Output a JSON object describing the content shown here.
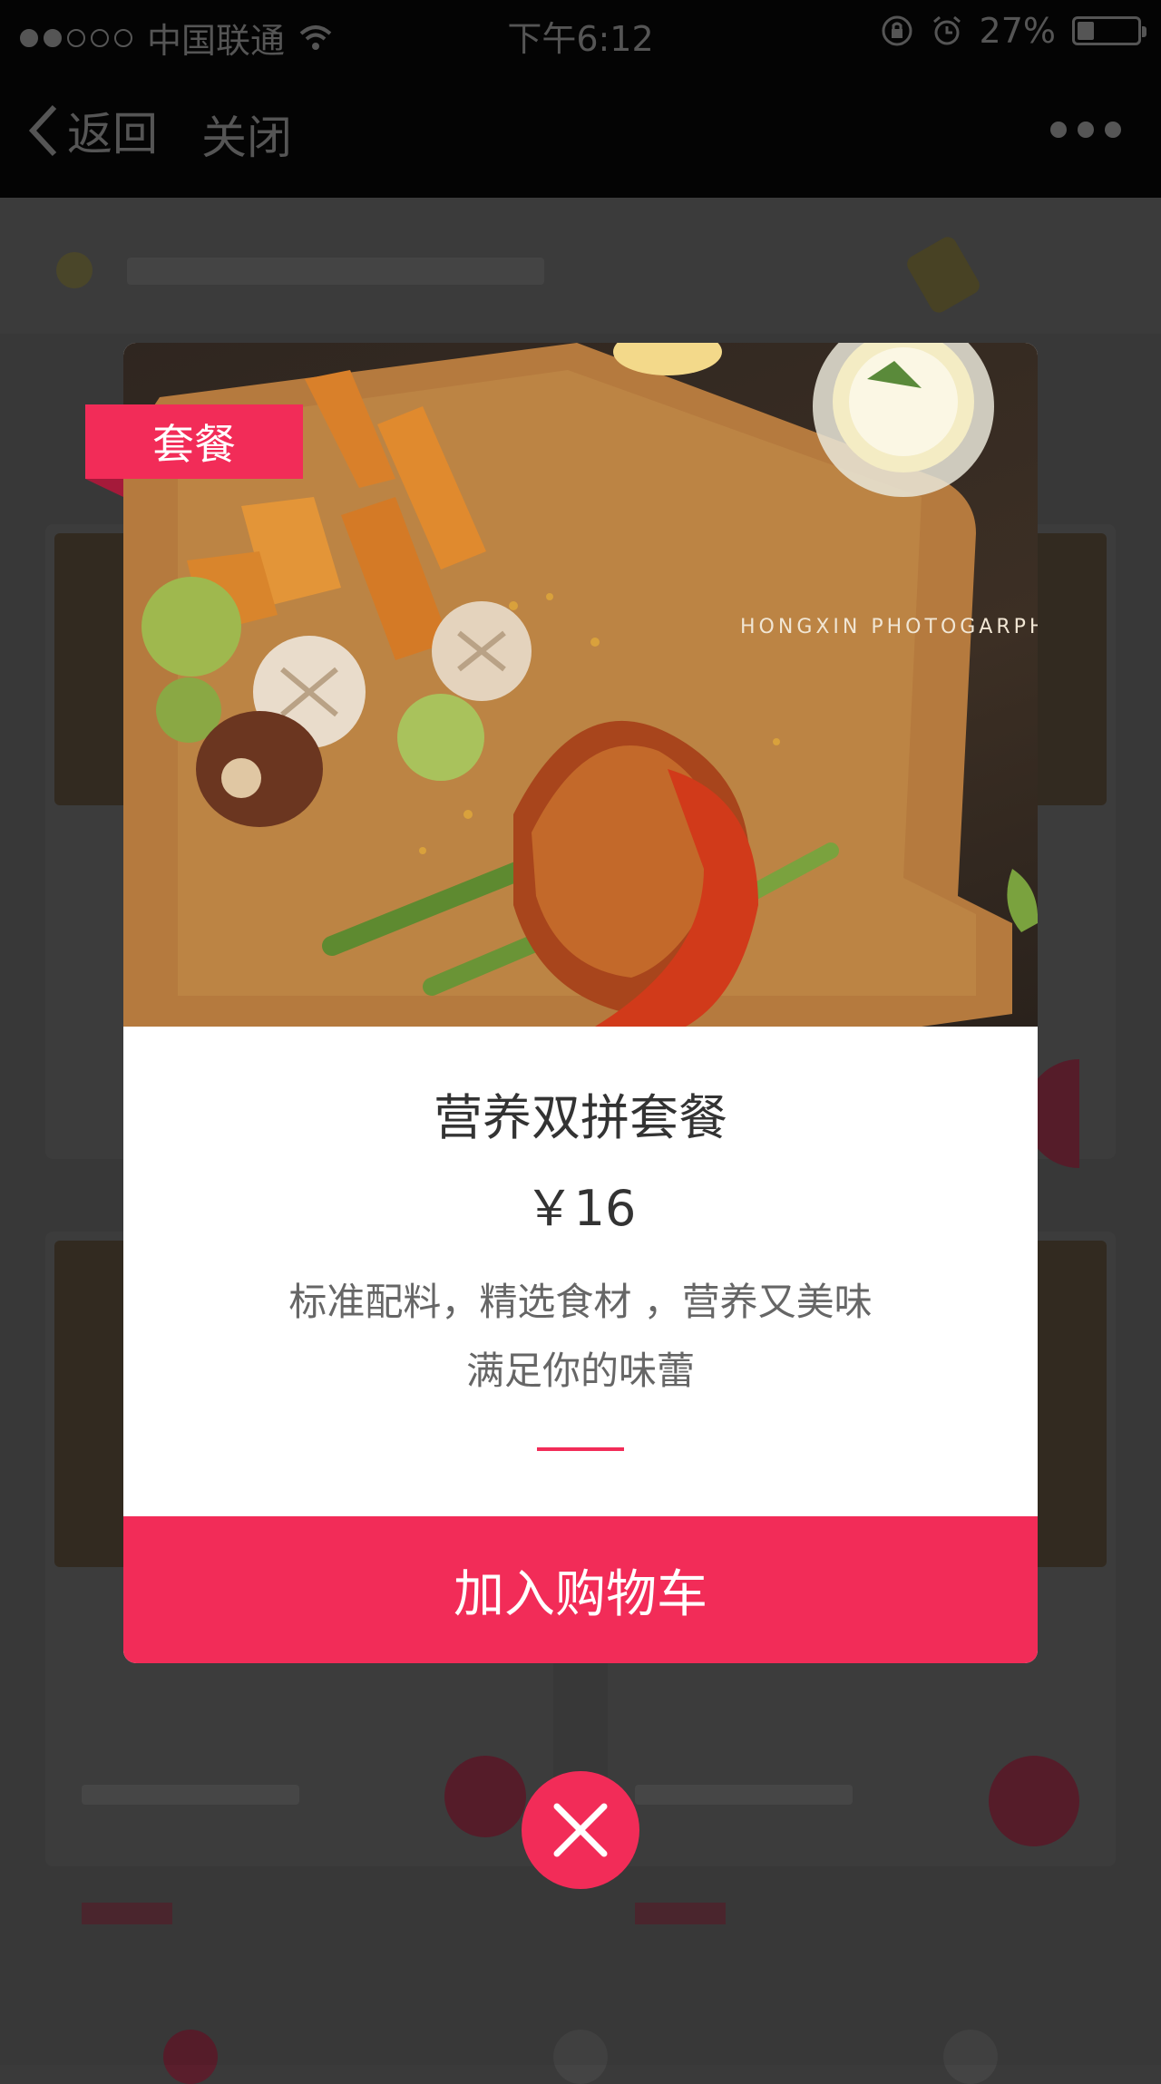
{
  "status_bar": {
    "carrier": "中国联通",
    "time": "下午6:12",
    "battery_percent": "27%",
    "battery_level": 0.27,
    "signal_bars_filled": 2,
    "signal_bars_total": 5
  },
  "nav": {
    "back_label": "返回",
    "close_label": "关闭"
  },
  "modal": {
    "badge": "套餐",
    "photo_watermark": "HONGXIN PHOTOGARPH",
    "dish_name": "营养双拼套餐",
    "price": "￥16",
    "description_line1": "标准配料，精选食材 ，营养又美味",
    "description_line2": "满足你的味蕾",
    "add_to_cart_label": "加入购物车"
  },
  "colors": {
    "accent": "#f22c58",
    "status_bar_bg": "#050505",
    "dim_background": "#3a3a3a"
  },
  "icons": {
    "back": "chevron-left-icon",
    "more": "more-dots-icon",
    "close": "close-x-icon",
    "wifi": "wifi-icon",
    "lock_rotation": "rotation-lock-icon",
    "alarm": "alarm-icon",
    "battery": "battery-icon"
  }
}
